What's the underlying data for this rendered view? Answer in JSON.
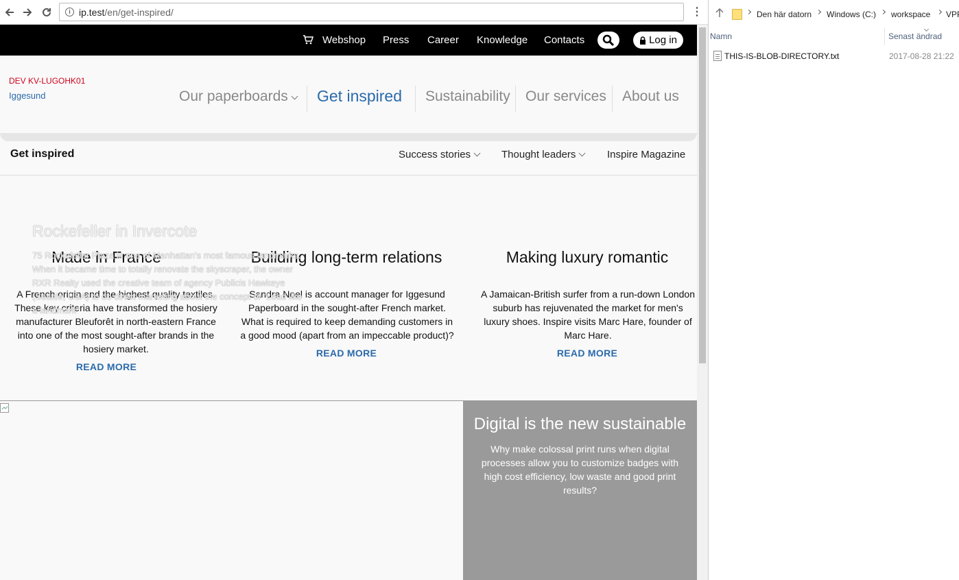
{
  "browser": {
    "url_host": "ip.test",
    "url_path": "/en/get-inspired/",
    "menu_glyph": "⋮"
  },
  "topbar": {
    "links": [
      "Webshop",
      "Press",
      "Career",
      "Knowledge",
      "Contacts"
    ],
    "login_label": "Log in"
  },
  "header": {
    "dev_label": "DEV KV-LUGOHK01",
    "logo_text": "Iggesund",
    "nav": [
      "Our paperboards",
      "Get inspired",
      "Sustainability",
      "Our services",
      "About us"
    ],
    "active_nav": "Get inspired"
  },
  "subnav": {
    "title": "Get inspired",
    "links": [
      "Success stories",
      "Thought leaders",
      "Inspire Magazine"
    ]
  },
  "ghost": {
    "title": "Rockefeller in Invercote",
    "body": "75 Rockefeller Plaza is one of Manhattan's most famous landmarks. When it became time to totally renovate the skyscraper, the owner RXR Realty used the creative team of agency Publicis Hawkeye (Seattle, USA) to do direct marketing about the concept of \"Lead like a landmark\""
  },
  "cards": [
    {
      "title": "Made in France",
      "body": "A French origin and the highest quality textiles. These key criteria have transformed the hosiery manufacturer Bleuforêt in north-eastern France into one of the most sought-after brands in the hosiery market.",
      "link": "READ MORE"
    },
    {
      "title": "Building long-term relations",
      "body": "Sandra Noel is account manager for Iggesund Paperboard in the sought-after French market. What is required to keep demanding customers in a good mood (apart from an impeccable product)?",
      "link": "READ MORE"
    },
    {
      "title": "Making luxury romantic",
      "body": "A Jamaican-British surfer from a run-down London suburb has rejuvenated the market for men's luxury shoes. Inspire visits Marc Hare, founder of Marc Hare.",
      "link": "READ MORE"
    }
  ],
  "promo": {
    "title": "Digital is the new sustainable",
    "body": "Why make colossal print runs when digital processes allow you to customize badges with high cost efficiency, low waste and good print results?"
  },
  "explorer": {
    "breadcrumb": [
      "Den här datorn",
      "Windows (C:)",
      "workspace",
      "VPP"
    ],
    "columns": [
      "Namn",
      "Senast ändrad"
    ],
    "files": [
      {
        "name": "THIS-IS-BLOB-DIRECTORY.txt",
        "modified": "2017-08-28 21:22"
      }
    ]
  },
  "colors": {
    "brand_blue": "#2a6aab",
    "dev_red": "#d0021b",
    "promo_gray": "#9a9a9a"
  }
}
